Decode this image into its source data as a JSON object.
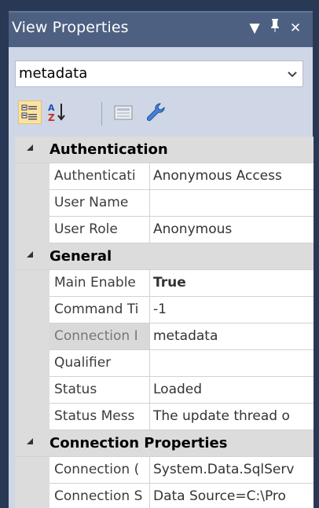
{
  "window": {
    "title": "View Properties",
    "dropdown_glyph": "▼",
    "pin_glyph": "Ꝑ",
    "close_glyph": "✕"
  },
  "selector": {
    "value": "metadata",
    "arrow_icon": "chevron-down-icon"
  },
  "toolbar": {
    "categorized_icon": "categorized-view-icon",
    "alphabetical_icon": "alphabetical-sort-icon",
    "property_pages_icon": "property-pages-icon",
    "settings_icon": "wrench-icon"
  },
  "grid": {
    "categories": [
      {
        "label": "Authentication",
        "rows": [
          {
            "name": "Authenticati",
            "value": "Anonymous Access"
          },
          {
            "name": "User Name",
            "value": ""
          },
          {
            "name": "User Role",
            "value": "Anonymous"
          }
        ]
      },
      {
        "label": "General",
        "rows": [
          {
            "name": "Main Enable",
            "value": "True"
          },
          {
            "name": "Command Ti",
            "value": "-1"
          },
          {
            "name": "Connection I",
            "value": "metadata"
          },
          {
            "name": "Qualifier",
            "value": ""
          },
          {
            "name": "Status",
            "value": "Loaded"
          },
          {
            "name": "Status Mess",
            "value": "The update thread o"
          }
        ]
      },
      {
        "label": "Connection Properties",
        "rows": [
          {
            "name": "Connection (",
            "value": "System.Data.SqlServ"
          },
          {
            "name": "Connection S",
            "value": "Data Source=C:\\Pro"
          }
        ]
      }
    ]
  }
}
